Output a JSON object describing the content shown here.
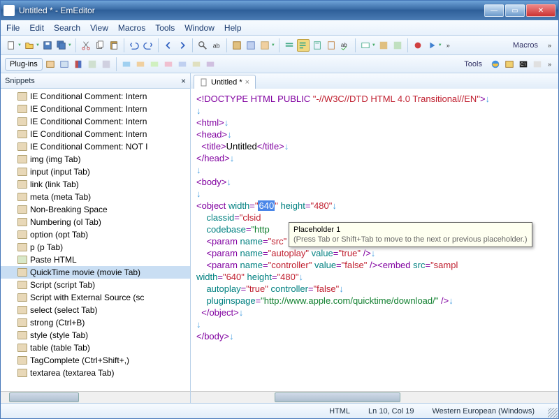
{
  "window": {
    "title": "Untitled * - EmEditor"
  },
  "menu": [
    "File",
    "Edit",
    "Search",
    "View",
    "Macros",
    "Tools",
    "Window",
    "Help"
  ],
  "toolbar_right": {
    "macros": "Macros",
    "tools": "Tools"
  },
  "plugins_label": "Plug-ins",
  "sidebar": {
    "title": "Snippets",
    "items": [
      "IE Conditional Comment: Intern",
      "IE Conditional Comment: Intern",
      "IE Conditional Comment: Intern",
      "IE Conditional Comment: Intern",
      "IE Conditional Comment: NOT I",
      "img  (img Tab)",
      "input  (input Tab)",
      "link  (link Tab)",
      "meta  (meta Tab)",
      "Non-Breaking Space",
      "Numbering  (ol Tab)",
      "option  (opt Tab)",
      "p  (p Tab)",
      "Paste HTML",
      "QuickTime movie  (movie Tab)",
      "Script  (script Tab)",
      "Script with External Source  (sc",
      "select  (select Tab)",
      "strong  (Ctrl+B)",
      "style  (style Tab)",
      "table  (table Tab)",
      "TagComplete  (Ctrl+Shift+,)",
      "textarea  (textarea Tab)"
    ],
    "selected_index": 14
  },
  "tab": {
    "label": "Untitled *"
  },
  "tooltip": {
    "line1": "Placeholder 1",
    "line2": "(Press Tab or Shift+Tab to move to the next or previous placeholder.)"
  },
  "code": {
    "doctype_prefix": "<!DOCTYPE HTML PUBLIC ",
    "doctype_val": "\"-//W3C//DTD HTML 4.0 Transitional//EN\"",
    "html_open": "<html>",
    "head_open": "<head>",
    "title_open": "<title>",
    "title_text": "Untitled",
    "title_close": "</title>",
    "head_close": "</head>",
    "body_open": "<body>",
    "obj_open": "<object ",
    "attr_width": "width",
    "val_640": "640",
    "attr_height": "height",
    "val_480": "480",
    "attr_classid": "classid",
    "val_clsid": "\"clsid",
    "attr_codebase": "codebase",
    "val_http": "\"http",
    "param_open": "<param ",
    "attr_name": "name",
    "attr_value": "value",
    "name_src": "\"src\"",
    "val_sample": "\"sample.mov\"",
    "name_autoplay": "\"autoplay\"",
    "val_true": "\"true\"",
    "name_controller": "\"controller\"",
    "val_false": "\"false\"",
    "embed_open": "<embed ",
    "attr_src": "src",
    "val_sampl": "\"sampl",
    "attr_autoplay": "autoplay",
    "attr_controller": "controller",
    "attr_pluginspage": "pluginspage",
    "val_plugins": "\"http://www.apple.com/quicktime/download/\"",
    "obj_close": "</object>",
    "body_close": "</body>",
    "close_slash": " />",
    "eq": "=",
    "gt": ">",
    "quote": "\""
  },
  "status": {
    "lang": "HTML",
    "pos": "Ln 10, Col 19",
    "enc": "Western European (Windows)"
  }
}
